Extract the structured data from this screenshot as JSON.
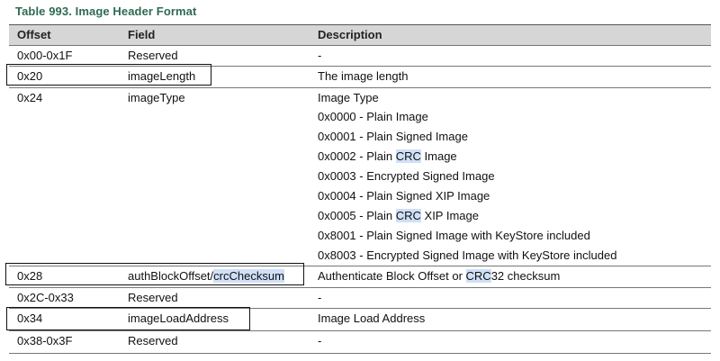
{
  "title": "Table 993.  Image Header Format",
  "headers": [
    "Offset",
    "Field",
    "Description"
  ],
  "rows": [
    {
      "offset": "0x00-0x1F",
      "field": "Reserved",
      "description": "-"
    },
    {
      "offset": "0x20",
      "field": "imageLength",
      "description": "The image length"
    },
    {
      "offset": "0x24",
      "field": "imageType",
      "description_lines": [
        "Image Type",
        "0x0000 - Plain Image",
        "0x0001 - Plain Signed Image",
        "0x0002 - Plain CRC Image",
        "0x0003 - Encrypted Signed Image",
        "0x0004 - Plain Signed XIP Image",
        "0x0005 - Plain CRC XIP Image",
        "0x8001 - Plain Signed Image with KeyStore included",
        "0x8003 - Encrypted Signed Image with KeyStore included"
      ]
    },
    {
      "offset": "0x28",
      "field": "authBlockOffset/crcChecksum",
      "description": "Authenticate Block Offset or CRC32 checksum"
    },
    {
      "offset": "0x2C-0x33",
      "field": "Reserved",
      "description": "-"
    },
    {
      "offset": "0x34",
      "field": "imageLoadAddress",
      "description": "Image Load Address"
    },
    {
      "offset": "0x38-0x3F",
      "field": "Reserved",
      "description": "-"
    }
  ]
}
